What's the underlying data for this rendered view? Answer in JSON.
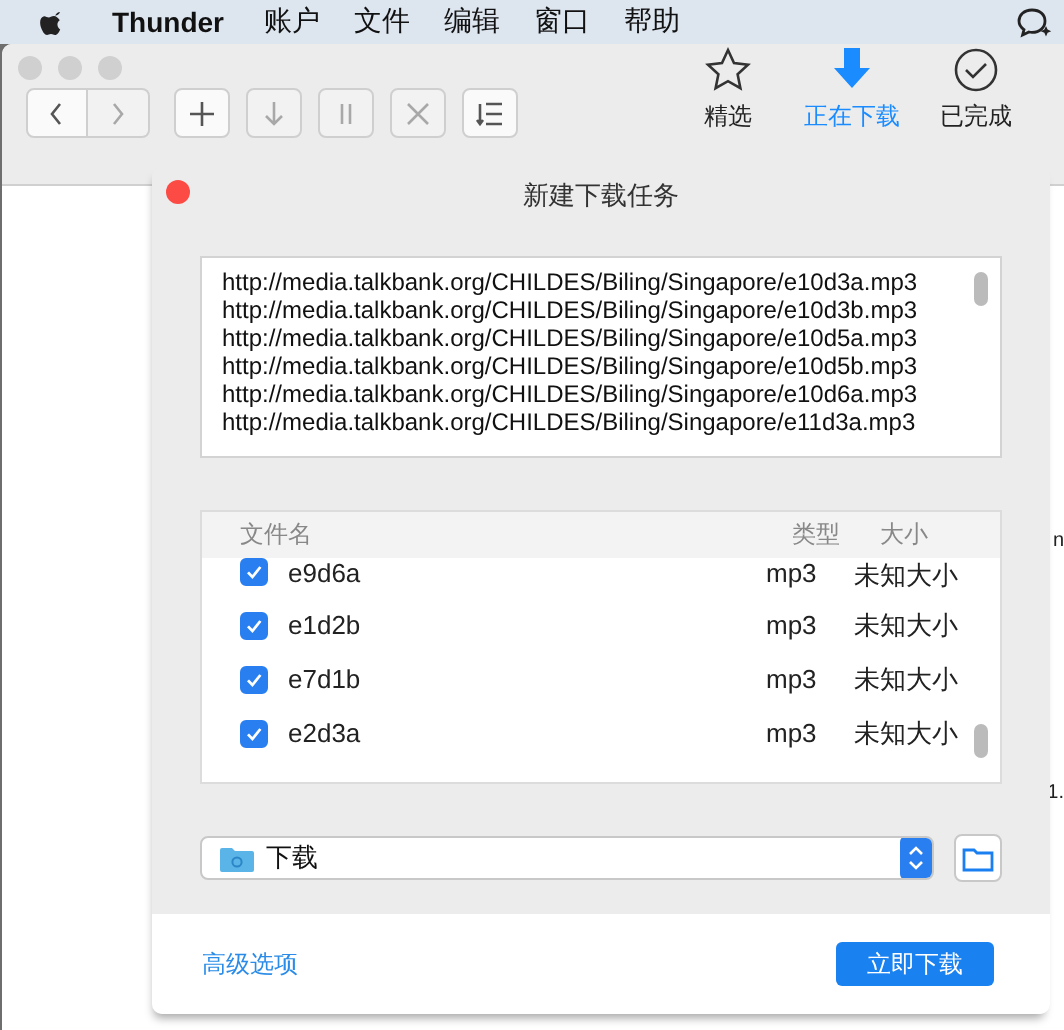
{
  "menu_bar": {
    "app_name": "Thunder",
    "items": [
      "账户",
      "文件",
      "编辑",
      "窗口",
      "帮助"
    ]
  },
  "toolbar": {
    "buttons": [
      {
        "kind": "back",
        "disabled": false
      },
      {
        "kind": "forward",
        "disabled": true
      },
      {
        "kind": "add",
        "disabled": false
      },
      {
        "kind": "download",
        "disabled": true
      },
      {
        "kind": "pause",
        "disabled": true
      },
      {
        "kind": "delete",
        "disabled": true
      },
      {
        "kind": "sort",
        "disabled": false
      }
    ],
    "tabs": [
      {
        "kind": "star",
        "label": "精选",
        "selected": false
      },
      {
        "kind": "download",
        "label": "正在下载",
        "selected": true
      },
      {
        "kind": "check",
        "label": "已完成",
        "selected": false
      }
    ]
  },
  "background_fragments": [
    "n",
    "1."
  ],
  "dialog": {
    "title": "新建下载任务",
    "urls": [
      "http://media.talkbank.org/CHILDES/Biling/Singapore/e10d3a.mp3",
      "http://media.talkbank.org/CHILDES/Biling/Singapore/e10d3b.mp3",
      "http://media.talkbank.org/CHILDES/Biling/Singapore/e10d5a.mp3",
      "http://media.talkbank.org/CHILDES/Biling/Singapore/e10d5b.mp3",
      "http://media.talkbank.org/CHILDES/Biling/Singapore/e10d6a.mp3",
      "http://media.talkbank.org/CHILDES/Biling/Singapore/e11d3a.mp3"
    ],
    "table": {
      "columns": [
        "文件名",
        "类型",
        "大小"
      ],
      "rows": [
        {
          "name": "e9d6a",
          "type": "mp3",
          "size": "未知大小",
          "checked": true
        },
        {
          "name": "e1d2b",
          "type": "mp3",
          "size": "未知大小",
          "checked": true
        },
        {
          "name": "e7d1b",
          "type": "mp3",
          "size": "未知大小",
          "checked": true
        },
        {
          "name": "e2d3a",
          "type": "mp3",
          "size": "未知大小",
          "checked": true
        }
      ]
    },
    "save_location": {
      "value": "下载"
    },
    "advanced_link": "高级选项",
    "primary_button": "立即下载"
  }
}
